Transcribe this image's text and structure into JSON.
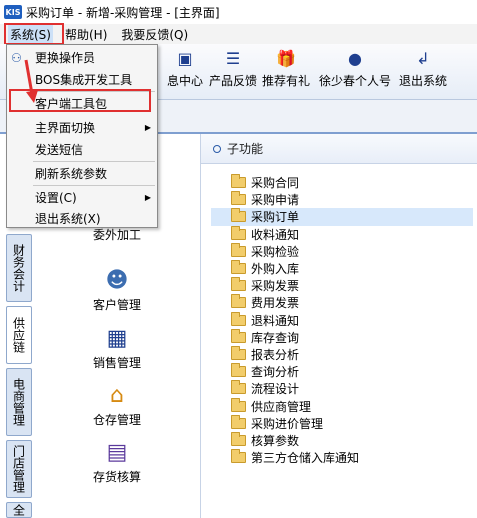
{
  "window": {
    "title": "采购订单 - 新增-采购管理 - [主界面]",
    "logo": "KIS"
  },
  "menubar": {
    "items": [
      {
        "label": "系统(S)"
      },
      {
        "label": "帮助(H)"
      },
      {
        "label": "我要反馈(Q)"
      }
    ]
  },
  "toolbar": {
    "items": [
      {
        "label": "息中心",
        "icon": "message-icon"
      },
      {
        "label": "产品反馈",
        "icon": "feedback-icon"
      },
      {
        "label": "推荐有礼",
        "icon": "gift-icon"
      },
      {
        "label": "徐少春个人号",
        "icon": "avatar-icon"
      },
      {
        "label": "退出系统",
        "icon": "exit-icon"
      }
    ]
  },
  "system_menu": {
    "items": [
      {
        "label": "更换操作员"
      },
      {
        "label": "BOS集成开发工具"
      },
      {
        "label": "客户端工具包"
      },
      {
        "label": "主界面切换"
      },
      {
        "label": "发送短信"
      },
      {
        "label": "刷新系统参数"
      },
      {
        "label": "设置(C)"
      },
      {
        "label": "退出系统(X)"
      }
    ]
  },
  "side_tabs": [
    {
      "label": "财务会计"
    },
    {
      "label": "供应链"
    },
    {
      "label": "电商管理"
    },
    {
      "label": "门店管理"
    },
    {
      "label": "全"
    }
  ],
  "modules": [
    {
      "label": "委外加工",
      "icon": "outsource-icon"
    },
    {
      "label": "客户管理",
      "icon": "customer-icon"
    },
    {
      "label": "销售管理",
      "icon": "sales-icon"
    },
    {
      "label": "仓存管理",
      "icon": "warehouse-icon"
    },
    {
      "label": "存货核算",
      "icon": "inventory-accounting-icon"
    }
  ],
  "subfunctions": {
    "title": "子功能",
    "selected_index": 2,
    "items": [
      "采购合同",
      "采购申请",
      "采购订单",
      "收料通知",
      "采购检验",
      "外购入库",
      "采购发票",
      "费用发票",
      "退料通知",
      "库存查询",
      "报表分析",
      "查询分析",
      "流程设计",
      "供应商管理",
      "采购进价管理",
      "核算参数",
      "第三方仓储入库通知"
    ]
  }
}
